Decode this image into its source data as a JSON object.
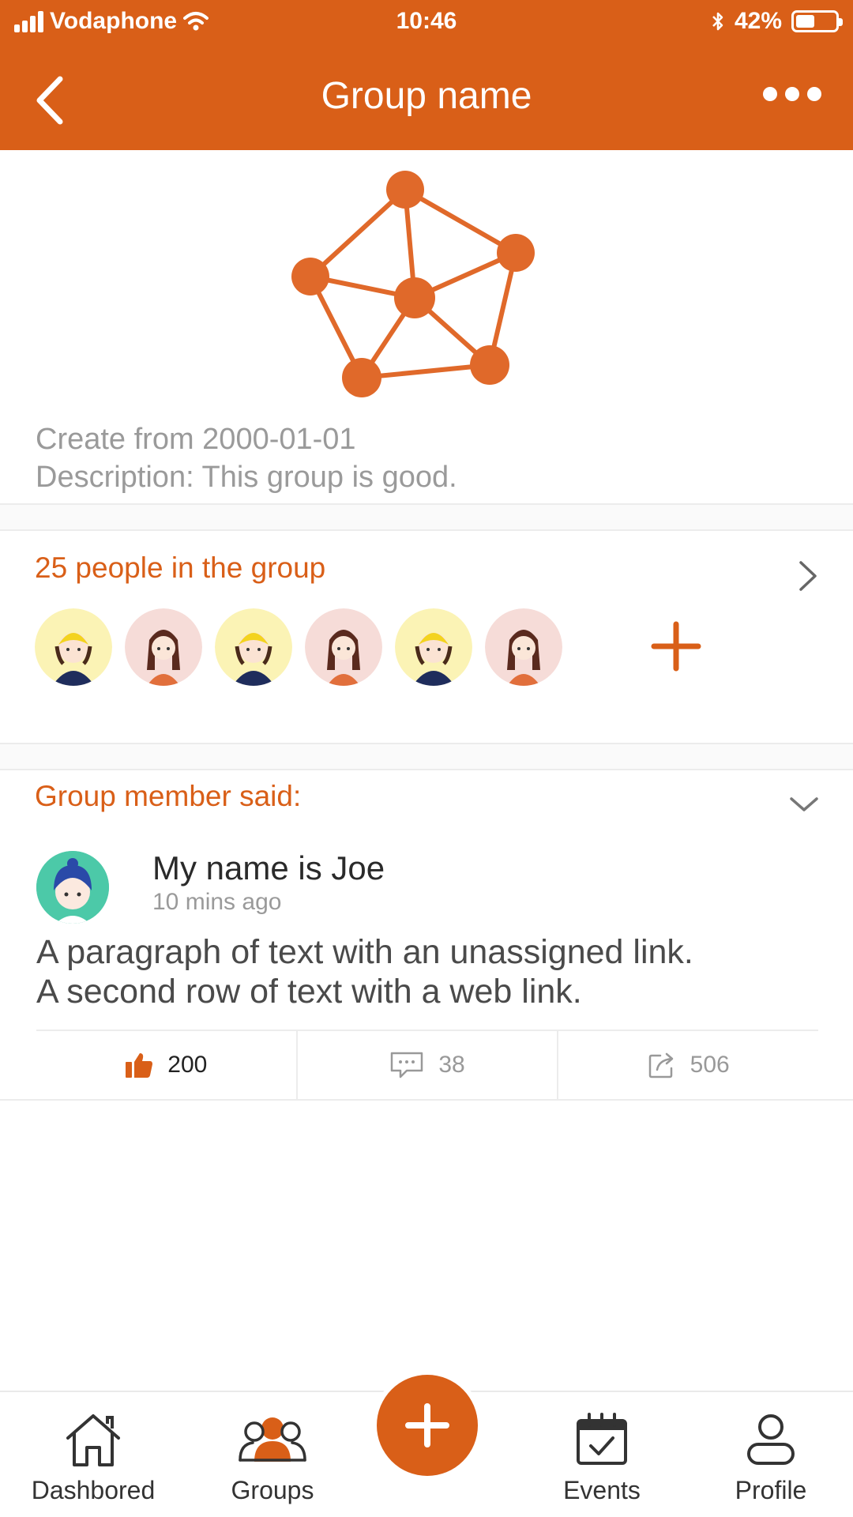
{
  "status_bar": {
    "carrier": "Vodaphone",
    "time": "10:46",
    "battery": "42%",
    "battery_level": 0.42
  },
  "header": {
    "title": "Group name",
    "back_icon": "chevron-left-icon",
    "more_icon": "more-horizontal-icon"
  },
  "group": {
    "created": "Create from 2000-01-01",
    "description": "Description: This group is good.",
    "logo_icon": "network-graph-icon"
  },
  "members": {
    "title": "25 people in the group",
    "avatars": [
      {
        "name": "member-avatar-yellow-hat"
      },
      {
        "name": "member-avatar-girl"
      },
      {
        "name": "member-avatar-yellow-hat"
      },
      {
        "name": "member-avatar-girl"
      },
      {
        "name": "member-avatar-yellow-hat"
      },
      {
        "name": "member-avatar-girl"
      }
    ]
  },
  "posts": {
    "title": "Group member said:",
    "item": {
      "author": "My name is Joe",
      "time": "10  mins ago",
      "line1": "A paragraph of text with an unassigned link.",
      "line2": "A second row of text with a web link.",
      "likes": "200",
      "comments": "38",
      "shares": "506"
    }
  },
  "bottom_nav": {
    "items": [
      {
        "label": "Dashbored",
        "icon": "home-icon"
      },
      {
        "label": "Groups",
        "icon": "groups-icon"
      },
      {
        "label": "Events",
        "icon": "calendar-check-icon"
      },
      {
        "label": "Profile",
        "icon": "user-icon"
      }
    ],
    "fab_icon": "plus-icon"
  },
  "colors": {
    "accent": "#d95f18",
    "muted": "#9a9a9a"
  }
}
